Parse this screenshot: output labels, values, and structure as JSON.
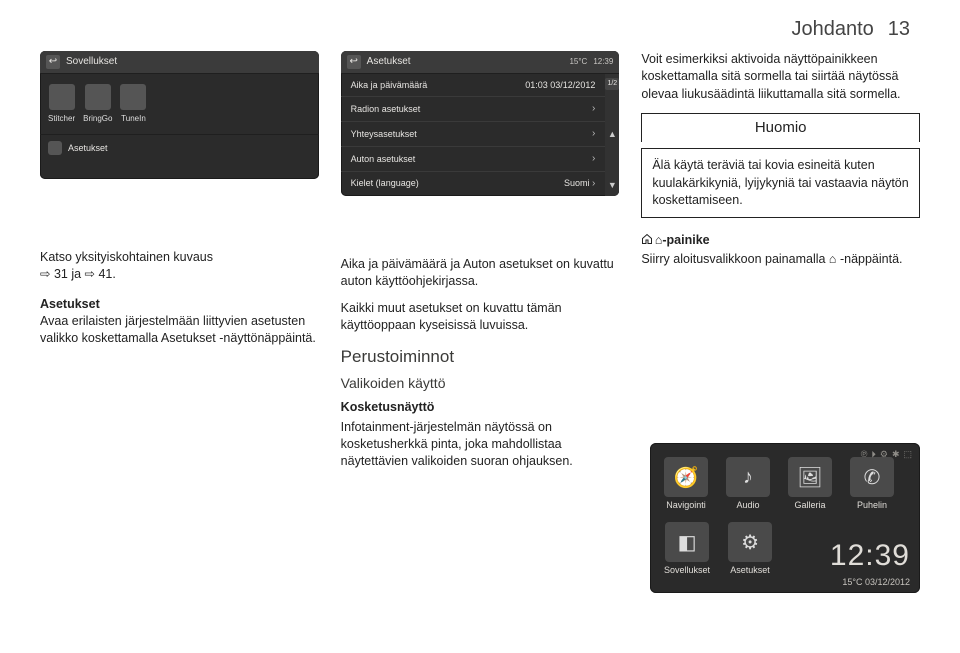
{
  "header": {
    "title": "Johdanto",
    "page": "13"
  },
  "device_apps": {
    "title": "Sovellukset",
    "tiles": [
      "Stitcher",
      "BringGo",
      "TuneIn"
    ],
    "footer": "Asetukset"
  },
  "device_settings": {
    "title": "Asetukset",
    "temp": "15°C",
    "time": "12:39",
    "page_ind": "1/2",
    "rows": [
      {
        "label": "Aika ja päivämäärä",
        "value": "01:03 03/12/2012"
      },
      {
        "label": "Radion asetukset",
        "value": ""
      },
      {
        "label": "Yhteysasetukset",
        "value": ""
      },
      {
        "label": "Auton asetukset",
        "value": ""
      },
      {
        "label": "Kielet (language)",
        "value": "Suomi"
      }
    ]
  },
  "col1": {
    "katso": "Katso yksityiskohtainen kuvaus",
    "katso_links": "⇨ 31 ja ⇨ 41.",
    "aset_title": "Asetukset",
    "aset_body": "Avaa erilaisten järjestelmään liittyvien asetusten valikko koskettamalla Asetukset -näyttönäppäintä."
  },
  "col2": {
    "p1": "Aika ja päivämäärä ja Auton asetukset on kuvattu auton käyttöohjekirjassa.",
    "p2": "Kaikki muut asetukset on kuvattu tämän käyttöoppaan kyseisissä luvuissa.",
    "sect": "Perustoiminnot",
    "sub": "Valikoiden käyttö",
    "mini": "Kosketusnäyttö",
    "body": "Infotainment-järjestelmän näytössä on kosketusherkkä pinta, joka mahdollistaa näytettävien valikoiden suoran ohjauksen."
  },
  "col3": {
    "p1": "Voit esimerkiksi aktivoida näyttöpainikkeen koskettamalla sitä sormella tai siirtää näytössä olevaa liukusäädintä liikuttamalla sitä sormella.",
    "notice_title": "Huomio",
    "notice_body": "Älä käytä teräviä tai kovia esineitä kuten kuulakärkikyniä, lyijykyniä tai vastaavia näytön koskettamiseen.",
    "home_title": "⌂-painike",
    "home_body": "Siirry aloitusvalikkoon painamalla ⌂ -näppäintä."
  },
  "home_device": {
    "tiles": [
      "Navigointi",
      "Audio",
      "Galleria",
      "Puhelin",
      "Sovellukset",
      "Asetukset"
    ],
    "status": [
      "℗",
      "⏵",
      "⚙",
      "✱",
      "⬚"
    ],
    "clock": "12:39",
    "date": "15°C    03/12/2012"
  }
}
